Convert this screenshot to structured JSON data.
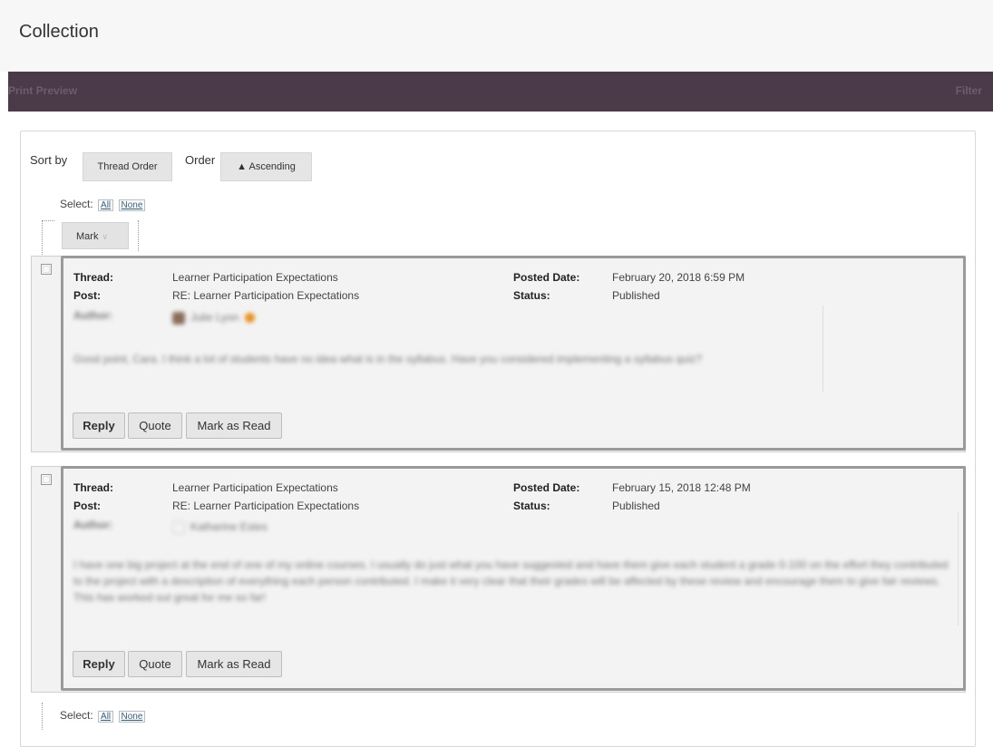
{
  "page": {
    "title": "Collection"
  },
  "action_bar": {
    "print_preview": "Print Preview",
    "filter": "Filter"
  },
  "sort": {
    "sort_by_label": "Sort by",
    "sort_by_value": "Thread Order",
    "order_label": "Order",
    "order_value": "▲ Ascending"
  },
  "select": {
    "label": "Select:",
    "all": "All",
    "none": "None"
  },
  "mark_menu": {
    "label": "Mark",
    "icon": "chevron-down-icon"
  },
  "field_labels": {
    "thread": "Thread:",
    "post": "Post:",
    "author": "Author:",
    "posted_date": "Posted Date:",
    "status": "Status:"
  },
  "posts": [
    {
      "thread": "Learner Participation Expectations",
      "post": "RE: Learner Participation Expectations",
      "posted_date": "February 20, 2018 6:59 PM",
      "status": "Published",
      "author": "Julie Lyon",
      "body": "Good point, Cara. I think a lot of students have no idea what is in the syllabus. Have you considered implementing a syllabus quiz?",
      "buttons": {
        "reply": "Reply",
        "quote": "Quote",
        "mark_read": "Mark as Read"
      }
    },
    {
      "thread": "Learner Participation Expectations",
      "post": "RE: Learner Participation Expectations",
      "posted_date": "February 15, 2018 12:48 PM",
      "status": "Published",
      "author": "Katharine Estes",
      "body": "I have one big project at the end of one of my online courses. I usually do just what you have suggested and have them give each student a grade 0-100 on the effort they contributed to the project with a description of everything each person contributed. I make it very clear that their grades will be affected by these review and encourage them to give fair reviews. This has worked out great for me so far!",
      "buttons": {
        "reply": "Reply",
        "quote": "Quote",
        "mark_read": "Mark as Read"
      }
    }
  ]
}
